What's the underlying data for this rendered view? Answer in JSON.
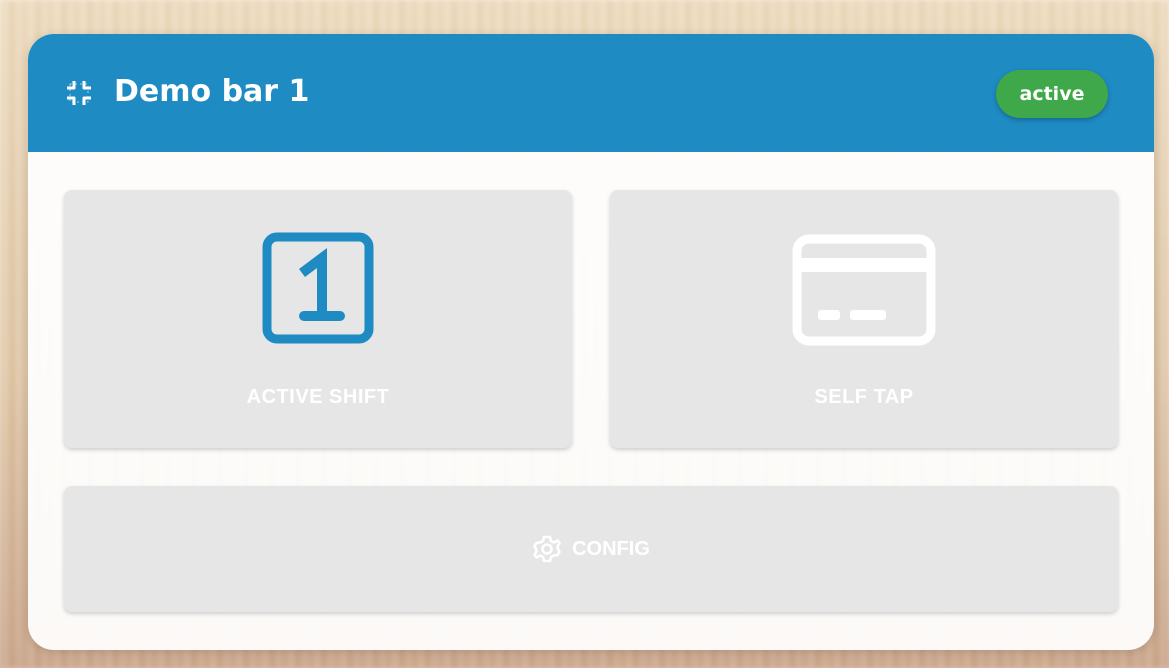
{
  "header": {
    "title": "Demo bar 1",
    "icon": "fullscreen-exit-icon",
    "status": "active",
    "color": "#1e8bc3"
  },
  "status_colors": {
    "active": "#3fa84a"
  },
  "tiles": [
    {
      "label": "ACTIVE SHIFT",
      "icon": "numeric-1-box-icon",
      "icon_color": "#1e8bc3"
    },
    {
      "label": "SELF TAP",
      "icon": "credit-card-icon",
      "icon_color": "#ffffff"
    }
  ],
  "config": {
    "label": "CONFIG",
    "icon": "gear-icon"
  }
}
